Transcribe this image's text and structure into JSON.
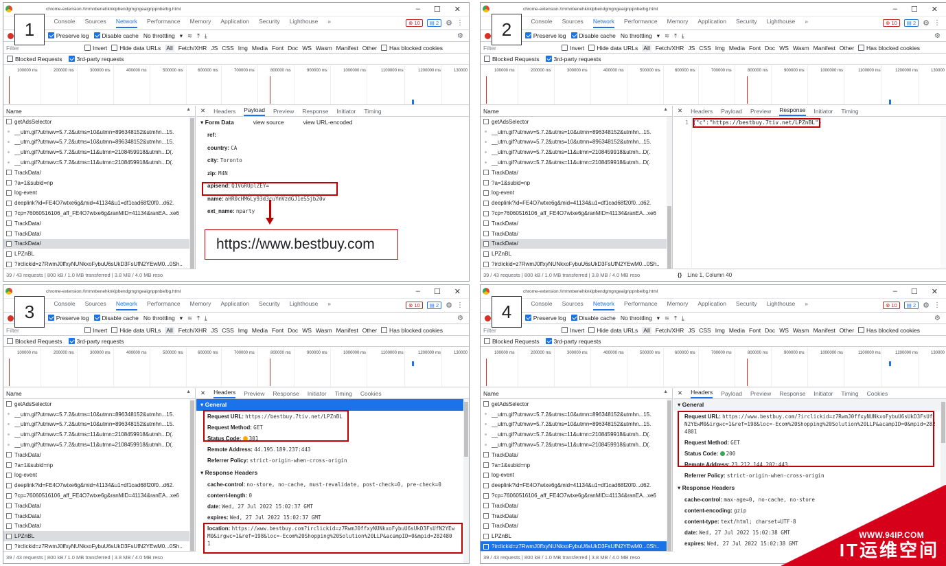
{
  "panels": [
    {
      "number": "1",
      "url": "chrome-extension://mmnbenehknklpbendgmgngeaignppnbe/bg.html",
      "window_controls": [
        "–",
        "☐",
        "✕"
      ],
      "devtools_tabs": [
        "Elements",
        "Console",
        "Sources",
        "Network",
        "Performance",
        "Memory",
        "Application",
        "Security",
        "Lighthouse",
        "»"
      ],
      "active_tab": "Network",
      "errors": "10",
      "messages": "2",
      "toolbar": {
        "preserve_log": "Preserve log",
        "disable_cache": "Disable cache",
        "throttling": "No throttling"
      },
      "filter": {
        "label": "Filter",
        "invert": "Invert",
        "hide_data_urls": "Hide data URLs",
        "types": [
          "All",
          "Fetch/XHR",
          "JS",
          "CSS",
          "Img",
          "Media",
          "Font",
          "Doc",
          "WS",
          "Wasm",
          "Manifest",
          "Other"
        ],
        "has_blocked_cookies": "Has blocked cookies",
        "blocked_requests": "Blocked Requests",
        "third_party": "3rd-party requests"
      },
      "timeline_ticks": [
        "100000 ms",
        "200000 ms",
        "300000 ms",
        "400000 ms",
        "500000 ms",
        "600000 ms",
        "700000 ms",
        "800000 ms",
        "900000 ms",
        "1000000 ms",
        "1100000 ms",
        "1200000 ms",
        "130000"
      ],
      "name_header": "Name",
      "requests": [
        {
          "name": "getAdsSelector",
          "kind": "sq"
        },
        {
          "name": "__utm.gif?utmwv=5.7.2&utms=10&utmn=896348152&utmhn...15.",
          "kind": "dot"
        },
        {
          "name": "__utm.gif?utmwv=5.7.2&utms=10&utmn=896348152&utmhn...15.",
          "kind": "dot"
        },
        {
          "name": "__utm.gif?utmwv=5.7.2&utms=11&utmn=2108459918&utmh...D(.",
          "kind": "dot"
        },
        {
          "name": "__utm.gif?utmwv=5.7.2&utms=11&utmn=2108459918&utmh...D(.",
          "kind": "dot"
        },
        {
          "name": "TrackData/",
          "kind": "sq"
        },
        {
          "name": "?a=1&subid=np",
          "kind": "sq"
        },
        {
          "name": "log-event",
          "kind": "sq"
        },
        {
          "name": "deeplink?id=FE4O7wtxe6g&mid=41134&u1=df1cad68f20f0...d62.",
          "kind": "sq"
        },
        {
          "name": "?cp=76060516106_aff_FE4O7wtxe6g&ranMID=41134&ranEA...xe6",
          "kind": "sq"
        },
        {
          "name": "TrackData/",
          "kind": "sq"
        },
        {
          "name": "TrackData/",
          "kind": "sq"
        },
        {
          "name": "TrackData/",
          "kind": "sq",
          "state": "sel"
        },
        {
          "name": "LPZnBL",
          "kind": "sq"
        },
        {
          "name": "?irclickid=z7RwmJ0ffxyNUNkxoFybuU6sUkD3FsUfN2YEwM0...0Sh..",
          "kind": "sq"
        }
      ],
      "status": "39 / 43 requests  |  800 kB / 1.0 MB transferred  |  3.8 MB / 4.0 MB reso",
      "detail_tabs": [
        "Headers",
        "Payload",
        "Preview",
        "Response",
        "Initiator",
        "Timing"
      ],
      "active_detail_tab": "Payload",
      "payload": {
        "section": "Form Data",
        "view_source": "view source",
        "view_url_encoded": "view URL-encoded",
        "fields": [
          {
            "k": "ref:",
            "v": ""
          },
          {
            "k": "country:",
            "v": "CA"
          },
          {
            "k": "city:",
            "v": "Toronto"
          },
          {
            "k": "zip:",
            "v": "M4N"
          },
          {
            "k": "apisend:",
            "v": "Q1VGRUplZEY="
          },
          {
            "k": "name:",
            "v": "aHR0cHM6Ly93d3cuYmVzdGJ1eS5jb20v"
          },
          {
            "k": "ext_name:",
            "v": "nparty"
          }
        ],
        "decoded": "https://www.bestbuy.com"
      }
    },
    {
      "number": "2",
      "url": "chrome-extension://mmnbenehknklpbendgmgngeaignppnbe/bg.html",
      "window_controls": [
        "–",
        "☐",
        "✕"
      ],
      "devtools_tabs": [
        "Elements",
        "Console",
        "Sources",
        "Network",
        "Performance",
        "Memory",
        "Application",
        "Security",
        "Lighthouse",
        "»"
      ],
      "active_tab": "Network",
      "errors": "10",
      "messages": "2",
      "toolbar": {
        "preserve_log": "Preserve log",
        "disable_cache": "Disable cache",
        "throttling": "No throttling"
      },
      "filter": {
        "label": "Filter",
        "invert": "Invert",
        "hide_data_urls": "Hide data URLs",
        "types": [
          "All",
          "Fetch/XHR",
          "JS",
          "CSS",
          "Img",
          "Media",
          "Font",
          "Doc",
          "WS",
          "Wasm",
          "Manifest",
          "Other"
        ],
        "has_blocked_cookies": "Has blocked cookies",
        "blocked_requests": "Blocked Requests",
        "third_party": "3rd-party requests"
      },
      "timeline_ticks": [
        "100000 ms",
        "200000 ms",
        "300000 ms",
        "400000 ms",
        "500000 ms",
        "600000 ms",
        "700000 ms",
        "800000 ms",
        "900000 ms",
        "1000000 ms",
        "1100000 ms",
        "1200000 ms",
        "130000"
      ],
      "name_header": "Name",
      "requests": [
        {
          "name": "getAdsSelector",
          "kind": "sq"
        },
        {
          "name": "__utm.gif?utmwv=5.7.2&utms=10&utmn=896348152&utmhn...15.",
          "kind": "dot"
        },
        {
          "name": "__utm.gif?utmwv=5.7.2&utms=10&utmn=896348152&utmhn...15.",
          "kind": "dot"
        },
        {
          "name": "__utm.gif?utmwv=5.7.2&utms=11&utmn=2108459918&utmh...D(.",
          "kind": "dot"
        },
        {
          "name": "__utm.gif?utmwv=5.7.2&utms=11&utmn=2108459918&utmh...D(.",
          "kind": "dot"
        },
        {
          "name": "TrackData/",
          "kind": "sq"
        },
        {
          "name": "?a=1&subid=np",
          "kind": "sq"
        },
        {
          "name": "log-event",
          "kind": "sq"
        },
        {
          "name": "deeplink?id=FE4O7wtxe6g&mid=41134&u1=df1cad68f20f0...d62.",
          "kind": "sq"
        },
        {
          "name": "?cp=76060516106_aff_FE4O7wtxe6g&ranMID=41134&ranEA...xe6",
          "kind": "sq"
        },
        {
          "name": "TrackData/",
          "kind": "sq"
        },
        {
          "name": "TrackData/",
          "kind": "sq"
        },
        {
          "name": "TrackData/",
          "kind": "sq",
          "state": "sel"
        },
        {
          "name": "LPZnBL",
          "kind": "sq"
        },
        {
          "name": "?irclickid=z7RwmJ0ffxyNUNkxoFybuU6sUkD3FsUfN2YEwM0...0Sh..",
          "kind": "sq"
        }
      ],
      "status": "39 / 43 requests  |  800 kB / 1.0 MB transferred  |  3.8 MB / 4.0 MB reso",
      "detail_tabs": [
        "Headers",
        "Payload",
        "Preview",
        "Response",
        "Initiator",
        "Timing"
      ],
      "active_detail_tab": "Response",
      "response": {
        "line_no": "1",
        "body": "{\"c\":\"https://bestbuy.7tiv.net/LPZnBL\"}",
        "footer": "Line 1, Column 40"
      }
    },
    {
      "number": "3",
      "url": "chrome-extension://mmnbenehknklpbendgmgngeaignppnbe/bg.html",
      "window_controls": [
        "–",
        "☐",
        "✕"
      ],
      "devtools_tabs": [
        "Elements",
        "Console",
        "Sources",
        "Network",
        "Performance",
        "Memory",
        "Application",
        "Security",
        "Lighthouse",
        "»"
      ],
      "active_tab": "Network",
      "errors": "10",
      "messages": "2",
      "toolbar": {
        "preserve_log": "Preserve log",
        "disable_cache": "Disable cache",
        "throttling": "No throttling"
      },
      "filter": {
        "label": "Filter",
        "invert": "Invert",
        "hide_data_urls": "Hide data URLs",
        "types": [
          "All",
          "Fetch/XHR",
          "JS",
          "CSS",
          "Img",
          "Media",
          "Font",
          "Doc",
          "WS",
          "Wasm",
          "Manifest",
          "Other"
        ],
        "has_blocked_cookies": "Has blocked cookies",
        "blocked_requests": "Blocked Requests",
        "third_party": "3rd-party requests"
      },
      "timeline_ticks": [
        "100000 ms",
        "200000 ms",
        "300000 ms",
        "400000 ms",
        "500000 ms",
        "600000 ms",
        "700000 ms",
        "800000 ms",
        "900000 ms",
        "1000000 ms",
        "1100000 ms",
        "1200000 ms",
        "130000"
      ],
      "name_header": "Name",
      "requests": [
        {
          "name": "getAdsSelector",
          "kind": "sq"
        },
        {
          "name": "__utm.gif?utmwv=5.7.2&utms=10&utmn=896348152&utmhn...15.",
          "kind": "dot"
        },
        {
          "name": "__utm.gif?utmwv=5.7.2&utms=10&utmn=896348152&utmhn...15.",
          "kind": "dot"
        },
        {
          "name": "__utm.gif?utmwv=5.7.2&utms=11&utmn=2108459918&utmh...D(.",
          "kind": "dot"
        },
        {
          "name": "__utm.gif?utmwv=5.7.2&utms=11&utmn=2108459918&utmh...D(.",
          "kind": "dot"
        },
        {
          "name": "TrackData/",
          "kind": "sq"
        },
        {
          "name": "?a=1&subid=np",
          "kind": "sq"
        },
        {
          "name": "log-event",
          "kind": "sq"
        },
        {
          "name": "deeplink?id=FE4O7wtxe6g&mid=41134&u1=df1cad68f20f0...d62.",
          "kind": "sq"
        },
        {
          "name": "?cp=76060516106_aff_FE4O7wtxe6g&ranMID=41134&ranEA...xe6",
          "kind": "sq"
        },
        {
          "name": "TrackData/",
          "kind": "sq"
        },
        {
          "name": "TrackData/",
          "kind": "sq"
        },
        {
          "name": "TrackData/",
          "kind": "sq"
        },
        {
          "name": "LPZnBL",
          "kind": "sq",
          "state": "sel"
        },
        {
          "name": "?irclickid=z7RwmJ0ffxyNUNkxoFybuU6sUkD3FsUfN2YEwM0...0Sh..",
          "kind": "sq"
        }
      ],
      "status": "39 / 43 requests  |  800 kB / 1.0 MB transferred  |  3.8 MB / 4.0 MB reso",
      "detail_tabs": [
        "Headers",
        "Preview",
        "Response",
        "Initiator",
        "Timing",
        "Cookies"
      ],
      "active_detail_tab": "Headers",
      "headers": {
        "general": "General",
        "general_rows": [
          {
            "k": "Request URL:",
            "v": "https://bestbuy.7tiv.net/LPZnBL"
          },
          {
            "k": "Request Method:",
            "v": "GET"
          },
          {
            "k": "Status Code:",
            "v": "301",
            "dot": "#f9ab00"
          },
          {
            "k": "Remote Address:",
            "v": "44.195.189.237:443"
          },
          {
            "k": "Referrer Policy:",
            "v": "strict-origin-when-cross-origin"
          }
        ],
        "response_headers": "Response Headers",
        "response_rows": [
          {
            "k": "cache-control:",
            "v": "no-store, no-cache, must-revalidate, post-check=0, pre-check=0"
          },
          {
            "k": "content-length:",
            "v": "0"
          },
          {
            "k": "date:",
            "v": "Wed, 27 Jul 2022 15:02:37 GMT"
          },
          {
            "k": "expires:",
            "v": "Wed, 27 Jul 2022 15:02:37 GMT"
          }
        ],
        "location_key": "location:",
        "location_lines": [
          "https://www.bestbuy.com?irclickid=z7RwmJ0ffxyNUNkxoFybuU6sUkD3FsUfN2YEw",
          "M0&irgwc=1&ref=198&loc=-Ecom%20Shopping%20Solution%20LLP&acampID=0&mpid=282480",
          "1"
        ]
      }
    },
    {
      "number": "4",
      "url": "chrome-extension://mmnbenehknklpbendgmgngeaignppnbe/bg.html",
      "window_controls": [
        "–",
        "☐",
        "✕"
      ],
      "devtools_tabs": [
        "Elements",
        "Console",
        "Sources",
        "Network",
        "Performance",
        "Memory",
        "Application",
        "Security",
        "Lighthouse",
        "»"
      ],
      "active_tab": "Network",
      "errors": "10",
      "messages": "2",
      "toolbar": {
        "preserve_log": "Preserve log",
        "disable_cache": "Disable cache",
        "throttling": "No throttling"
      },
      "filter": {
        "label": "Filter",
        "invert": "Invert",
        "hide_data_urls": "Hide data URLs",
        "types": [
          "All",
          "Fetch/XHR",
          "JS",
          "CSS",
          "Img",
          "Media",
          "Font",
          "Doc",
          "WS",
          "Wasm",
          "Manifest",
          "Other"
        ],
        "has_blocked_cookies": "Has blocked cookies",
        "blocked_requests": "Blocked Requests",
        "third_party": "3rd-party requests"
      },
      "timeline_ticks": [
        "100000 ms",
        "200000 ms",
        "300000 ms",
        "400000 ms",
        "500000 ms",
        "600000 ms",
        "700000 ms",
        "800000 ms",
        "900000 ms",
        "1000000 ms",
        "1100000 ms",
        "1200000 ms",
        "130000"
      ],
      "name_header": "Name",
      "requests": [
        {
          "name": "getAdsSelector",
          "kind": "sq"
        },
        {
          "name": "__utm.gif?utmwv=5.7.2&utms=10&utmn=896348152&utmhn...15.",
          "kind": "dot"
        },
        {
          "name": "__utm.gif?utmwv=5.7.2&utms=10&utmn=896348152&utmhn...15.",
          "kind": "dot"
        },
        {
          "name": "__utm.gif?utmwv=5.7.2&utms=11&utmn=2108459918&utmh...D(.",
          "kind": "dot"
        },
        {
          "name": "__utm.gif?utmwv=5.7.2&utms=11&utmn=2108459918&utmh...D(.",
          "kind": "dot"
        },
        {
          "name": "TrackData/",
          "kind": "sq"
        },
        {
          "name": "?a=1&subid=np",
          "kind": "sq"
        },
        {
          "name": "log-event",
          "kind": "sq"
        },
        {
          "name": "deeplink?id=FE4O7wtxe6g&mid=41134&u1=df1cad68f20f0...d62.",
          "kind": "sq"
        },
        {
          "name": "?cp=76060516106_aff_FE4O7wtxe6g&ranMID=41134&ranEA...xe6",
          "kind": "sq"
        },
        {
          "name": "TrackData/",
          "kind": "sq"
        },
        {
          "name": "TrackData/",
          "kind": "sq"
        },
        {
          "name": "TrackData/",
          "kind": "sq"
        },
        {
          "name": "LPZnBL",
          "kind": "sq"
        },
        {
          "name": "?irclickid=z7RwmJ0ffxyNUNkxoFybuU6sUkD3FsUfN2YEwM0...0Sh..",
          "kind": "sq",
          "state": "selblue"
        }
      ],
      "status": "39 / 43 requests  |  800 kB / 1.0 MB transferred  |  3.8 MB / 4.0 MB reso",
      "detail_tabs": [
        "Headers",
        "Payload",
        "Preview",
        "Response",
        "Initiator",
        "Timing",
        "Cookies"
      ],
      "active_detail_tab": "Headers",
      "headers": {
        "general": "General",
        "request_url_key": "Request URL:",
        "request_url_lines": [
          "https://www.bestbuy.com/?irclickid=z7RwmJ0ffxyNUNkxoFybuU6sUkD3FsUf",
          "N2YEwM0&irgwc=1&ref=198&loc=-Ecom%20Shopping%20Solution%20LLP&acampID=0&mpid=282",
          "4801"
        ],
        "general_rows": [
          {
            "k": "Request Method:",
            "v": "GET"
          },
          {
            "k": "Status Code:",
            "v": "200",
            "dot": "#34a853"
          },
          {
            "k": "Remote Address:",
            "v": "23.212.144.202:443"
          },
          {
            "k": "Referrer Policy:",
            "v": "strict-origin-when-cross-origin"
          }
        ],
        "response_headers": "Response Headers",
        "response_rows": [
          {
            "k": "cache-control:",
            "v": "max-age=0, no-cache, no-store"
          },
          {
            "k": "content-encoding:",
            "v": "gzip"
          },
          {
            "k": "content-type:",
            "v": "text/html; charset=UTF-8"
          },
          {
            "k": "date:",
            "v": "Wed, 27 Jul 2022 15:02:38 GMT"
          },
          {
            "k": "expires:",
            "v": "Wed, 27 Jul 2022 15:02:38 GMT"
          }
        ]
      }
    }
  ],
  "watermark": {
    "line1": "WWW.94IP.COM",
    "line2": "IT运维空间"
  },
  "colors": {
    "accent": "#1a73e8",
    "highlight_box": "#c00000",
    "error": "#d93025",
    "watermark": "#d7001a"
  }
}
